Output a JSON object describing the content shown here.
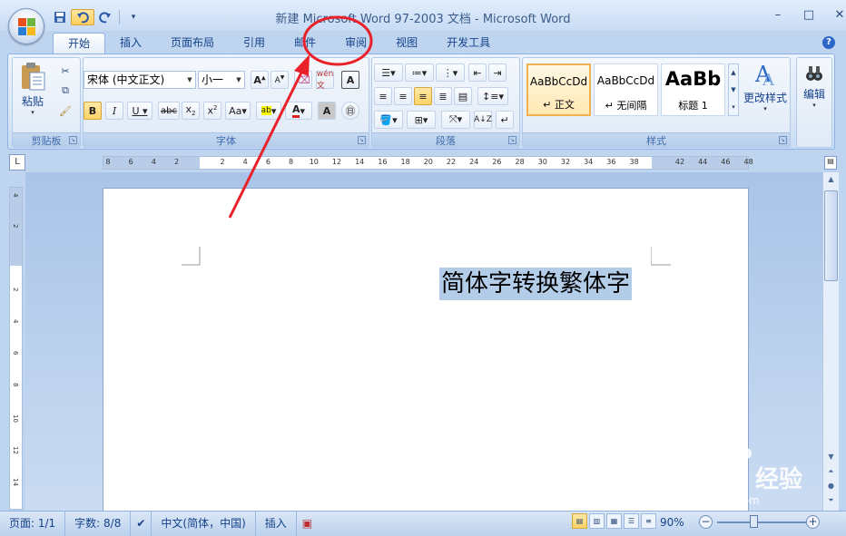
{
  "window": {
    "title": "新建 Microsoft Word 97-2003 文档 - Microsoft Word",
    "controls": [
      "–",
      "□",
      "✕"
    ]
  },
  "tabs": [
    {
      "label": "开始",
      "active": true
    },
    {
      "label": "插入"
    },
    {
      "label": "页面布局"
    },
    {
      "label": "引用"
    },
    {
      "label": "邮件"
    },
    {
      "label": "审阅"
    },
    {
      "label": "视图"
    },
    {
      "label": "开发工具"
    }
  ],
  "ribbon": {
    "clipboard": {
      "label": "剪贴板",
      "paste": "粘贴"
    },
    "font": {
      "label": "字体",
      "font_name": "宋体 (中文正文)",
      "font_size": "小一"
    },
    "paragraph": {
      "label": "段落"
    },
    "styles": {
      "label": "样式",
      "items": [
        {
          "sample": "AaBbCcDd",
          "name": "↵ 正文"
        },
        {
          "sample": "AaBbCcDd",
          "name": "↵ 无间隔"
        },
        {
          "sample": "AaBb",
          "name": "标题 1"
        }
      ],
      "change_styles": "更改样式"
    },
    "editing": {
      "label": "编辑"
    }
  },
  "ruler": {
    "h_ticks": [
      "8",
      "6",
      "4",
      "2",
      "2",
      "4",
      "6",
      "8",
      "10",
      "12",
      "14",
      "16",
      "18",
      "20",
      "22",
      "24",
      "26",
      "28",
      "30",
      "32",
      "34",
      "36",
      "38",
      "42",
      "44",
      "46",
      "48"
    ],
    "v_ticks": [
      "4",
      "2",
      "2",
      "4",
      "6",
      "8",
      "10",
      "12",
      "14"
    ]
  },
  "document": {
    "selected_text": "简体字转换繁体字"
  },
  "statusbar": {
    "page": "页面: 1/1",
    "words": "字数: 8/8",
    "language": "中文(简体，中国)",
    "mode": "插入",
    "zoom": "90%"
  },
  "colors": {
    "ribbon_bg": "#dce8f7",
    "selection": "#b3cde9",
    "annotation_red": "#e8212a",
    "active_style": "#f0b14e"
  },
  "watermark": {
    "brand": "Baidu经验",
    "url": "jingyan.baidu.com"
  }
}
